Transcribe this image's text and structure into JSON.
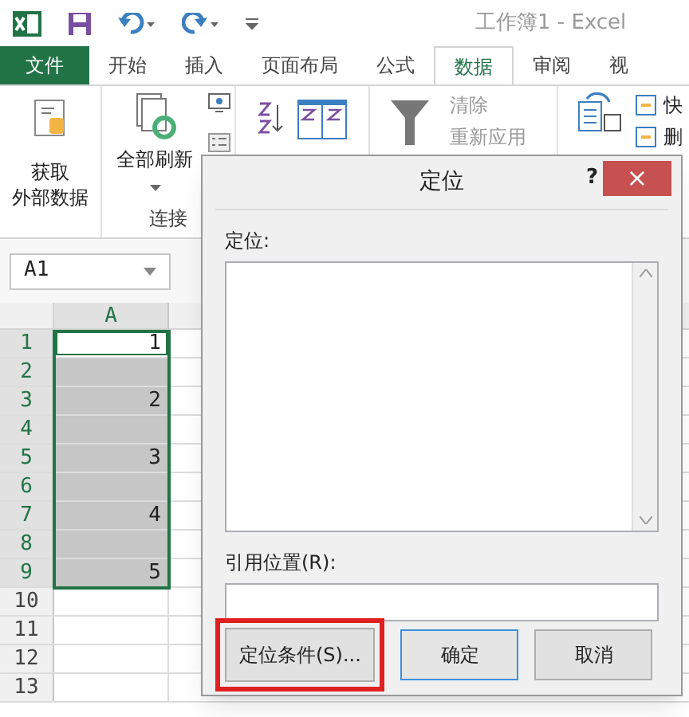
{
  "title_bar": {
    "title": "工作簿1 - Excel"
  },
  "tabs": [
    {
      "label": "文件",
      "kind": "file",
      "selected": false
    },
    {
      "label": "开始",
      "kind": "tab",
      "selected": false
    },
    {
      "label": "插入",
      "kind": "tab",
      "selected": false
    },
    {
      "label": "页面布局",
      "kind": "tab",
      "selected": false
    },
    {
      "label": "公式",
      "kind": "tab",
      "selected": false
    },
    {
      "label": "数据",
      "kind": "tab",
      "selected": true
    },
    {
      "label": "审阅",
      "kind": "tab",
      "selected": false
    },
    {
      "label": "视",
      "kind": "tab",
      "selected": false
    }
  ],
  "ribbon": {
    "get_data": [
      "获取",
      "外部数据"
    ],
    "refresh_all": "全部刷新",
    "group_label": "连接",
    "clear": {
      "label": "清除",
      "disabled": true
    },
    "reapply": {
      "label": "重新应用",
      "disabled": true
    },
    "right_items": [
      "快",
      "删"
    ]
  },
  "name_box": {
    "value": "A1"
  },
  "sheet": {
    "column": "A",
    "rows": [
      {
        "number": "1",
        "value": "1",
        "selected": true,
        "active": true
      },
      {
        "number": "2",
        "selected": true,
        "active": false
      },
      {
        "number": "3",
        "value": "2",
        "selected": true,
        "active": false
      },
      {
        "number": "4",
        "selected": true,
        "active": false
      },
      {
        "number": "5",
        "value": "3",
        "selected": true,
        "active": false
      },
      {
        "number": "6",
        "selected": true,
        "active": false
      },
      {
        "number": "7",
        "value": "4",
        "selected": true,
        "active": false
      },
      {
        "number": "8",
        "selected": true,
        "active": false
      },
      {
        "number": "9",
        "value": "5",
        "selected": true,
        "active": false
      },
      {
        "number": "10",
        "selected": false,
        "active": false
      },
      {
        "number": "11",
        "selected": false,
        "active": false
      },
      {
        "number": "12",
        "selected": false,
        "active": false
      },
      {
        "number": "13",
        "selected": false,
        "active": false
      }
    ]
  },
  "dialog": {
    "title": "定位",
    "help": "?",
    "close": "×",
    "goto_label": "定位:",
    "reference_label": "引用位置(R):",
    "buttons": [
      {
        "label": "定位条件(S)...",
        "highlighted": true,
        "default": false
      },
      {
        "label": "确定",
        "highlighted": false,
        "default": true
      },
      {
        "label": "取消",
        "highlighted": false,
        "default": false
      }
    ]
  }
}
